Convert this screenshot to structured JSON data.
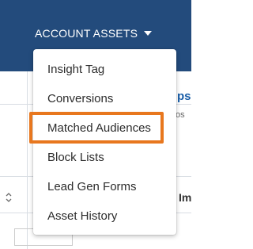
{
  "topbar": {
    "label": "ACCOUNT ASSETS",
    "caret_icon": "caret-down-icon",
    "background": "#234b7c"
  },
  "background": {
    "partial_heading": "ps",
    "partial_subtext": "os",
    "partial_column": "Im"
  },
  "dropdown": {
    "items": [
      {
        "label": "Insight Tag"
      },
      {
        "label": "Conversions"
      },
      {
        "label": "Matched Audiences",
        "highlighted": true
      },
      {
        "label": "Block Lists"
      },
      {
        "label": "Lead Gen Forms"
      },
      {
        "label": "Asset History"
      }
    ]
  },
  "highlight_color": "#e8771e"
}
